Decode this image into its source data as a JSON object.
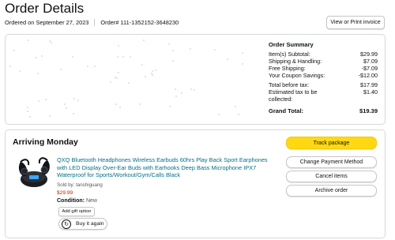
{
  "header": {
    "title": "Order Details",
    "ordered_on": "Ordered on September 27, 2023",
    "order_number": "Order# 111-1352152-3648230",
    "print_button": "View or Print invoice"
  },
  "summary": {
    "title": "Order Summary",
    "rows": [
      {
        "label": "Item(s) Subtotal:",
        "value": "$29.99"
      },
      {
        "label": "Shipping & Handling:",
        "value": "$7.09"
      },
      {
        "label": "Free Shipping:",
        "value": "-$7.09"
      },
      {
        "label": "Your Coupon Savings:",
        "value": "-$12.00"
      },
      {
        "label": "Total before tax:",
        "value": "$17.99"
      },
      {
        "label": "Estimated tax to be collected:",
        "value": "$1.40"
      }
    ],
    "grand_total_label": "Grand Total:",
    "grand_total_value": "$19.39"
  },
  "shipment": {
    "status": "Arriving Monday",
    "product_title": "QXQ Bluetooth Headphones Wireless Earbuds 60hrs Play Back Sport Earphones with LED Display Over-Ear Buds with Earhooks Deep Bass Microphone IPX7 Waterproof for Sports/Workout/Gym/Calls Black",
    "sold_by": "Sold by: tanshiguang",
    "price": "$29.99",
    "condition_label": "Condition:",
    "condition_value": "New",
    "gift_button": "Add gift option",
    "buy_again_button": "Buy it again",
    "buy_again_icon": "reorder-icon"
  },
  "actions": {
    "track": "Track package",
    "change_payment": "Change Payment Method",
    "cancel": "Cancel items",
    "archive": "Archive order"
  },
  "colors": {
    "link": "#007185",
    "price": "#b12704",
    "primary_button": "#ffd814",
    "border": "#d5d9d9"
  }
}
